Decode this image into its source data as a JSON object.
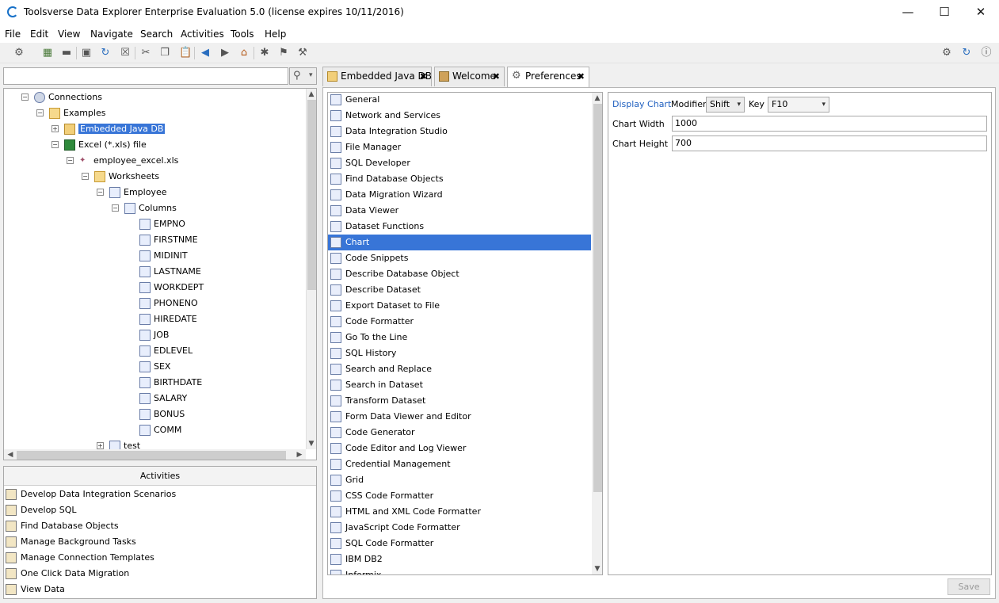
{
  "window": {
    "title": "Toolsverse Data Explorer Enterprise Evaluation 5.0 (license expires 10/11/2016)",
    "minimize": "—",
    "maximize": "☐",
    "close": "✕"
  },
  "menu": [
    "File",
    "Edit",
    "View",
    "Navigate",
    "Search",
    "Activities",
    "Tools",
    "Help"
  ],
  "search": {
    "value": "",
    "icon": "search-icon"
  },
  "tree": [
    {
      "label": "Connections",
      "level": 0,
      "toggle": "−",
      "icon": "globe-icon"
    },
    {
      "label": "Examples",
      "level": 1,
      "toggle": "−",
      "icon": "folder-icon"
    },
    {
      "label": "Embedded Java DB",
      "level": 2,
      "toggle": "+",
      "icon": "database-icon",
      "selected": true
    },
    {
      "label": "Excel (*.xls) file",
      "level": 2,
      "toggle": "−",
      "icon": "excel-icon"
    },
    {
      "label": "employee_excel.xls",
      "level": 3,
      "toggle": "−",
      "icon": "file-icon"
    },
    {
      "label": "Worksheets",
      "level": 4,
      "toggle": "−",
      "icon": "folder-icon"
    },
    {
      "label": "Employee",
      "level": 5,
      "toggle": "−",
      "icon": "table-icon"
    },
    {
      "label": "Columns",
      "level": 6,
      "toggle": "−",
      "icon": "columns-icon"
    },
    {
      "label": "EMPNO",
      "level": 7,
      "icon": "column-icon"
    },
    {
      "label": "FIRSTNME",
      "level": 7,
      "icon": "column-icon"
    },
    {
      "label": "MIDINIT",
      "level": 7,
      "icon": "column-icon"
    },
    {
      "label": "LASTNAME",
      "level": 7,
      "icon": "column-icon"
    },
    {
      "label": "WORKDEPT",
      "level": 7,
      "icon": "column-icon"
    },
    {
      "label": "PHONENO",
      "level": 7,
      "icon": "column-icon"
    },
    {
      "label": "HIREDATE",
      "level": 7,
      "icon": "column-icon"
    },
    {
      "label": "JOB",
      "level": 7,
      "icon": "column-icon"
    },
    {
      "label": "EDLEVEL",
      "level": 7,
      "icon": "column-icon"
    },
    {
      "label": "SEX",
      "level": 7,
      "icon": "column-icon"
    },
    {
      "label": "BIRTHDATE",
      "level": 7,
      "icon": "column-icon"
    },
    {
      "label": "SALARY",
      "level": 7,
      "icon": "column-icon"
    },
    {
      "label": "BONUS",
      "level": 7,
      "icon": "column-icon"
    },
    {
      "label": "COMM",
      "level": 7,
      "icon": "column-icon"
    },
    {
      "label": "test",
      "level": 5,
      "toggle": "+",
      "icon": "table-icon"
    }
  ],
  "activities": {
    "title": "Activities",
    "items": [
      "Develop Data Integration Scenarios",
      "Develop SQL",
      "Find Database Objects",
      "Manage Background Tasks",
      "Manage Connection Templates",
      "One Click Data Migration",
      "View Data"
    ]
  },
  "tabs": [
    {
      "label": "Embedded Java DB",
      "close": "✖",
      "active": false
    },
    {
      "label": "Welcome",
      "close": "✖",
      "active": false
    },
    {
      "label": "Preferences",
      "close": "✖",
      "active": true
    }
  ],
  "preferences": {
    "items": [
      "General",
      "Network and Services",
      "Data Integration Studio",
      "File Manager",
      "SQL Developer",
      "Find Database Objects",
      "Data Migration Wizard",
      "Data Viewer",
      "Dataset Functions",
      "Chart",
      "Code Snippets",
      "Describe Database Object",
      "Describe Dataset",
      "Export Dataset to File",
      "Code Formatter",
      "Go To the Line",
      "SQL History",
      "Search and Replace",
      "Search in Dataset",
      "Transform Dataset",
      "Form Data Viewer and Editor",
      "Code Generator",
      "Code Editor and Log Viewer",
      "Credential Management",
      "Grid",
      "CSS Code Formatter",
      "HTML and XML Code Formatter",
      "JavaScript Code Formatter",
      "SQL Code Formatter",
      "IBM DB2",
      "Informix"
    ],
    "selected_index": 9
  },
  "chart_settings": {
    "display_chart_label": "Display Chart",
    "modifier_label": "Modifier",
    "modifier_value": "Shift",
    "key_label": "Key",
    "key_value": "F10",
    "width_label": "Chart Width",
    "width_value": "1000",
    "height_label": "Chart Height",
    "height_value": "700",
    "link_color": "#1f5fbf"
  },
  "save_label": "Save",
  "colors": {
    "selection": "#3875d7",
    "accent": "#1670c8"
  }
}
